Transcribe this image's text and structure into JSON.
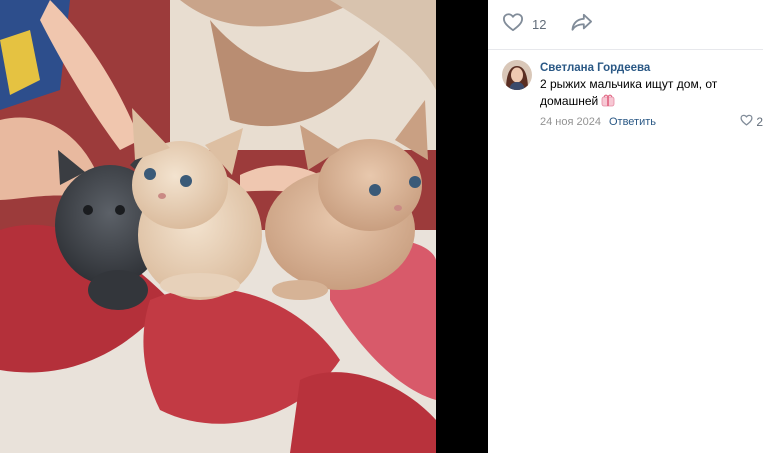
{
  "post_actions": {
    "like_count": "12",
    "like_icon": "heart-outline-icon",
    "share_icon": "share-arrow-icon"
  },
  "comment": {
    "author": "Светлана Гордеева",
    "text": "2 рыжих мальчика ищут дом, от домашней",
    "emoji_icon": "pink-ribbon-emoji",
    "date": "24 ноя 2024",
    "reply_label": "Ответить",
    "like_count": "2"
  },
  "colors": {
    "link": "#2a5885",
    "muted": "#939393",
    "icon": "#818c99"
  }
}
